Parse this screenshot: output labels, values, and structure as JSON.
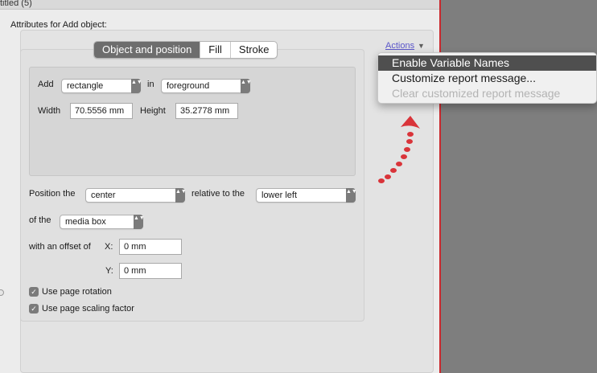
{
  "window": {
    "title_fragment": "titled (5)"
  },
  "attributes_label": "Attributes for Add object:",
  "tabs": [
    {
      "label": "Object and position",
      "active": true
    },
    {
      "label": "Fill",
      "active": false
    },
    {
      "label": "Stroke",
      "active": false
    }
  ],
  "add_row": {
    "add_label": "Add",
    "shape_value": "rectangle",
    "in_label": "in",
    "layer_value": "foreground"
  },
  "size_row": {
    "width_label": "Width",
    "width_value": "70.5556 mm",
    "height_label": "Height",
    "height_value": "35.2778 mm"
  },
  "position": {
    "position_label": "Position the",
    "anchor_value": "center",
    "relative_label": "relative to the",
    "reference_value": "lower left",
    "of_the_label": "of the",
    "box_value": "media box",
    "offset_label": "with an offset of",
    "x_label": "X:",
    "x_value": "0 mm",
    "y_label": "Y:",
    "y_value": "0 mm"
  },
  "options": {
    "page_rotation_label": "Use page rotation",
    "page_rotation_checked": true,
    "page_scaling_label": "Use page scaling factor",
    "page_scaling_checked": true
  },
  "actions": {
    "link_label": "Actions",
    "caret_glyph": "▼",
    "menu_items": [
      {
        "label": "Enable Variable Names",
        "state": "highlighted"
      },
      {
        "label": "Customize report message...",
        "state": "enabled"
      },
      {
        "label": "Clear customized report message",
        "state": "disabled"
      }
    ]
  },
  "glyphs": {
    "popup_arrows": "▲▼",
    "checkmark": "✓"
  },
  "colors": {
    "accent_link": "#5a55c9",
    "annotation_arrow": "#d9343a",
    "right_pane": "#7e7e7e",
    "menu_highlight": "#4f4f4f"
  }
}
